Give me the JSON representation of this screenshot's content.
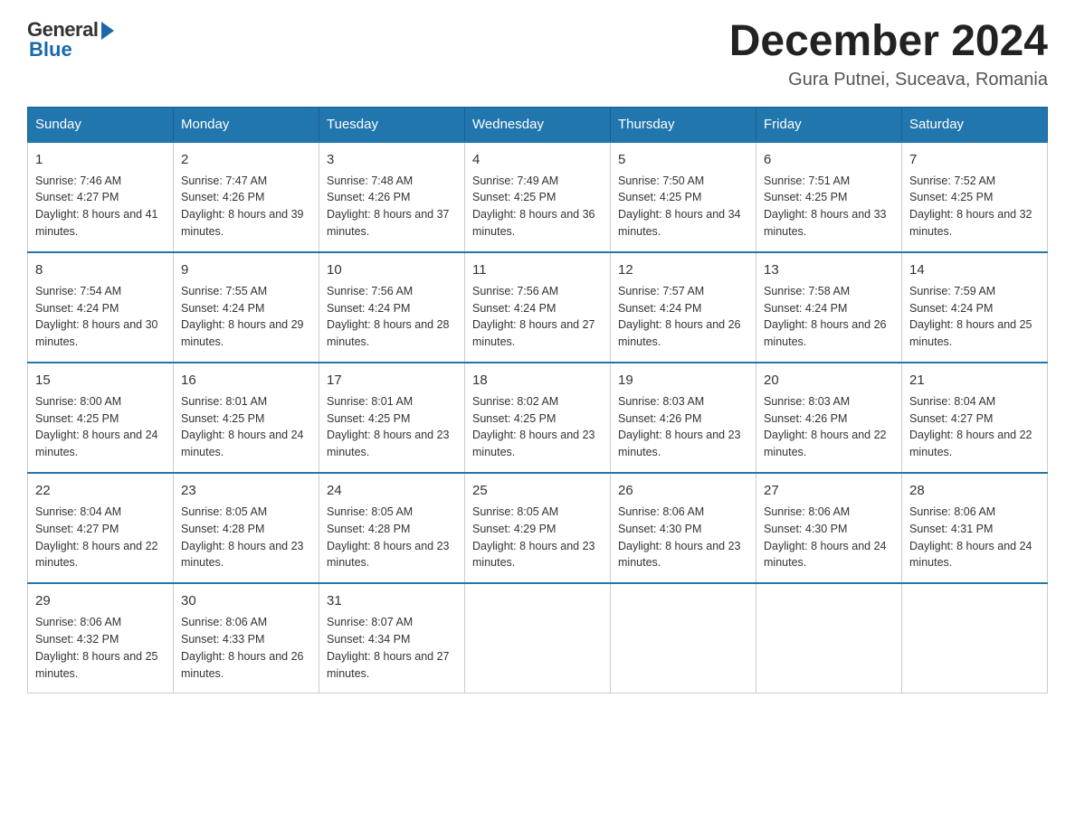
{
  "logo": {
    "general": "General",
    "blue": "Blue"
  },
  "title": "December 2024",
  "location": "Gura Putnei, Suceava, Romania",
  "days_of_week": [
    "Sunday",
    "Monday",
    "Tuesday",
    "Wednesday",
    "Thursday",
    "Friday",
    "Saturday"
  ],
  "weeks": [
    [
      {
        "day": "1",
        "sunrise": "7:46 AM",
        "sunset": "4:27 PM",
        "daylight": "8 hours and 41 minutes."
      },
      {
        "day": "2",
        "sunrise": "7:47 AM",
        "sunset": "4:26 PM",
        "daylight": "8 hours and 39 minutes."
      },
      {
        "day": "3",
        "sunrise": "7:48 AM",
        "sunset": "4:26 PM",
        "daylight": "8 hours and 37 minutes."
      },
      {
        "day": "4",
        "sunrise": "7:49 AM",
        "sunset": "4:25 PM",
        "daylight": "8 hours and 36 minutes."
      },
      {
        "day": "5",
        "sunrise": "7:50 AM",
        "sunset": "4:25 PM",
        "daylight": "8 hours and 34 minutes."
      },
      {
        "day": "6",
        "sunrise": "7:51 AM",
        "sunset": "4:25 PM",
        "daylight": "8 hours and 33 minutes."
      },
      {
        "day": "7",
        "sunrise": "7:52 AM",
        "sunset": "4:25 PM",
        "daylight": "8 hours and 32 minutes."
      }
    ],
    [
      {
        "day": "8",
        "sunrise": "7:54 AM",
        "sunset": "4:24 PM",
        "daylight": "8 hours and 30 minutes."
      },
      {
        "day": "9",
        "sunrise": "7:55 AM",
        "sunset": "4:24 PM",
        "daylight": "8 hours and 29 minutes."
      },
      {
        "day": "10",
        "sunrise": "7:56 AM",
        "sunset": "4:24 PM",
        "daylight": "8 hours and 28 minutes."
      },
      {
        "day": "11",
        "sunrise": "7:56 AM",
        "sunset": "4:24 PM",
        "daylight": "8 hours and 27 minutes."
      },
      {
        "day": "12",
        "sunrise": "7:57 AM",
        "sunset": "4:24 PM",
        "daylight": "8 hours and 26 minutes."
      },
      {
        "day": "13",
        "sunrise": "7:58 AM",
        "sunset": "4:24 PM",
        "daylight": "8 hours and 26 minutes."
      },
      {
        "day": "14",
        "sunrise": "7:59 AM",
        "sunset": "4:24 PM",
        "daylight": "8 hours and 25 minutes."
      }
    ],
    [
      {
        "day": "15",
        "sunrise": "8:00 AM",
        "sunset": "4:25 PM",
        "daylight": "8 hours and 24 minutes."
      },
      {
        "day": "16",
        "sunrise": "8:01 AM",
        "sunset": "4:25 PM",
        "daylight": "8 hours and 24 minutes."
      },
      {
        "day": "17",
        "sunrise": "8:01 AM",
        "sunset": "4:25 PM",
        "daylight": "8 hours and 23 minutes."
      },
      {
        "day": "18",
        "sunrise": "8:02 AM",
        "sunset": "4:25 PM",
        "daylight": "8 hours and 23 minutes."
      },
      {
        "day": "19",
        "sunrise": "8:03 AM",
        "sunset": "4:26 PM",
        "daylight": "8 hours and 23 minutes."
      },
      {
        "day": "20",
        "sunrise": "8:03 AM",
        "sunset": "4:26 PM",
        "daylight": "8 hours and 22 minutes."
      },
      {
        "day": "21",
        "sunrise": "8:04 AM",
        "sunset": "4:27 PM",
        "daylight": "8 hours and 22 minutes."
      }
    ],
    [
      {
        "day": "22",
        "sunrise": "8:04 AM",
        "sunset": "4:27 PM",
        "daylight": "8 hours and 22 minutes."
      },
      {
        "day": "23",
        "sunrise": "8:05 AM",
        "sunset": "4:28 PM",
        "daylight": "8 hours and 23 minutes."
      },
      {
        "day": "24",
        "sunrise": "8:05 AM",
        "sunset": "4:28 PM",
        "daylight": "8 hours and 23 minutes."
      },
      {
        "day": "25",
        "sunrise": "8:05 AM",
        "sunset": "4:29 PM",
        "daylight": "8 hours and 23 minutes."
      },
      {
        "day": "26",
        "sunrise": "8:06 AM",
        "sunset": "4:30 PM",
        "daylight": "8 hours and 23 minutes."
      },
      {
        "day": "27",
        "sunrise": "8:06 AM",
        "sunset": "4:30 PM",
        "daylight": "8 hours and 24 minutes."
      },
      {
        "day": "28",
        "sunrise": "8:06 AM",
        "sunset": "4:31 PM",
        "daylight": "8 hours and 24 minutes."
      }
    ],
    [
      {
        "day": "29",
        "sunrise": "8:06 AM",
        "sunset": "4:32 PM",
        "daylight": "8 hours and 25 minutes."
      },
      {
        "day": "30",
        "sunrise": "8:06 AM",
        "sunset": "4:33 PM",
        "daylight": "8 hours and 26 minutes."
      },
      {
        "day": "31",
        "sunrise": "8:07 AM",
        "sunset": "4:34 PM",
        "daylight": "8 hours and 27 minutes."
      },
      null,
      null,
      null,
      null
    ]
  ],
  "sunrise_label": "Sunrise:",
  "sunset_label": "Sunset:",
  "daylight_label": "Daylight:"
}
